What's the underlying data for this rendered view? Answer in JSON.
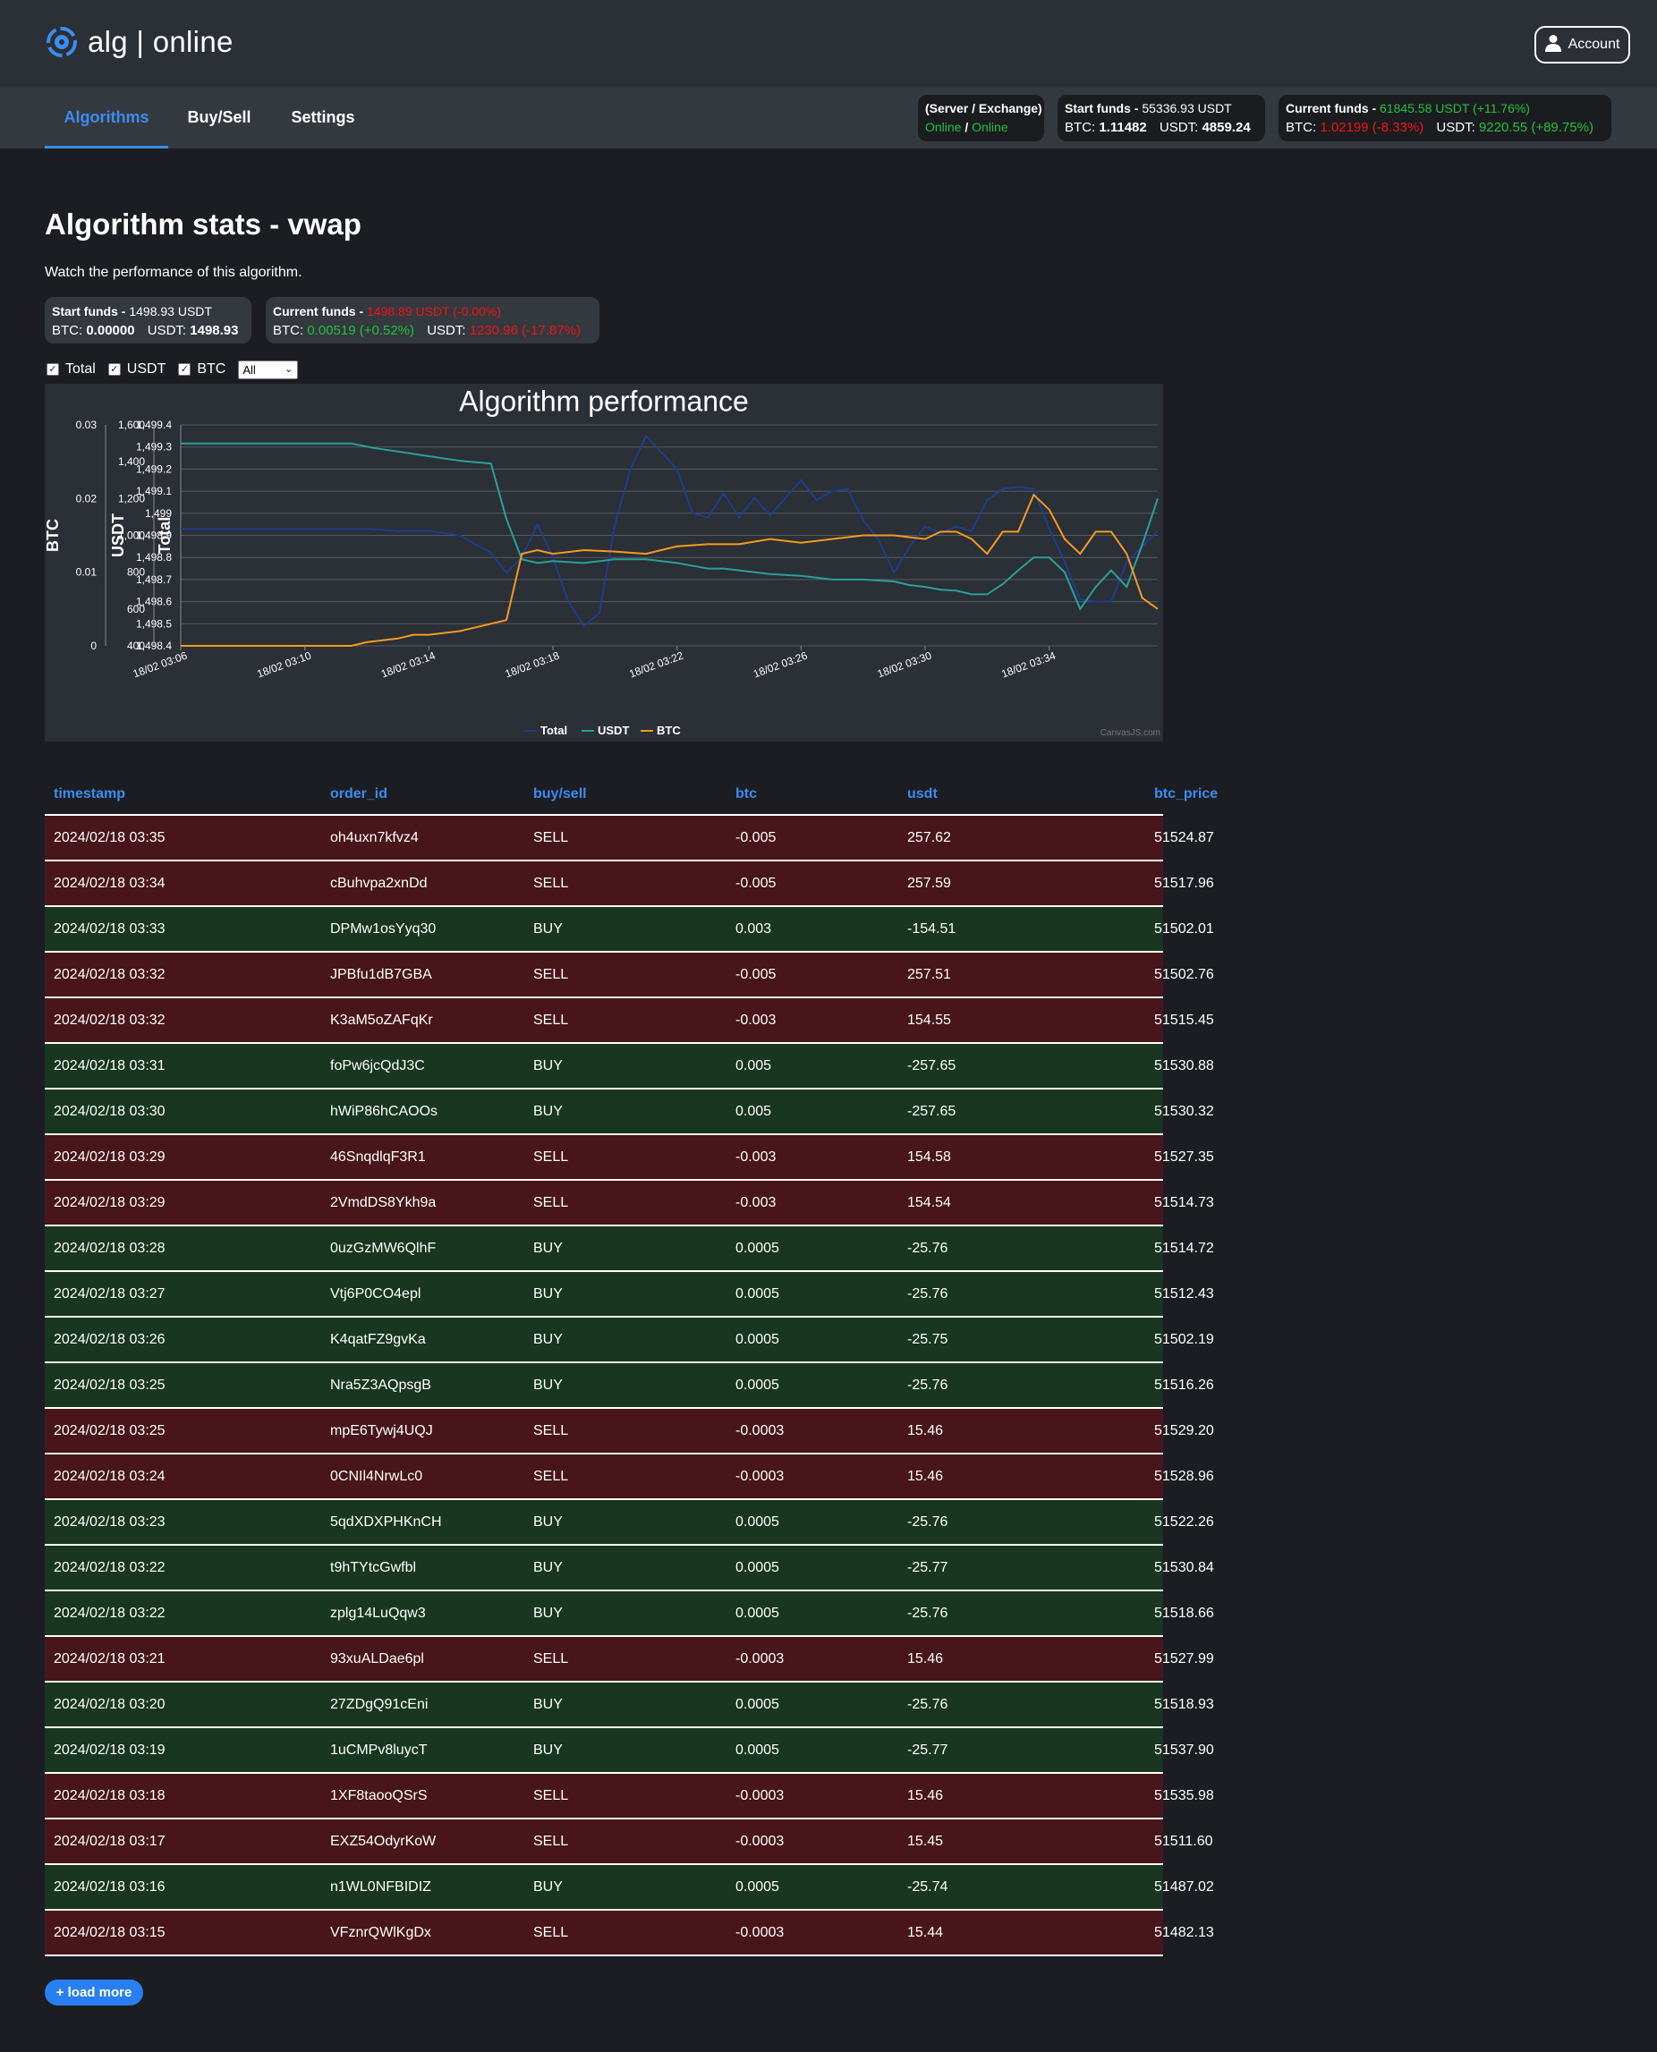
{
  "app": {
    "logo_text": "alg | online",
    "account_label": "Account"
  },
  "nav": {
    "tabs": [
      {
        "label": "Algorithms",
        "active": true
      },
      {
        "label": "Buy/Sell",
        "active": false
      },
      {
        "label": "Settings",
        "active": false
      }
    ]
  },
  "status": {
    "server_label": "(Server / Exchange)",
    "server_status": "Online",
    "separator": "/",
    "exchange_status": "Online",
    "start_funds_label": "Start funds - ",
    "start_funds_value": "55336.93 USDT",
    "start_btc_label": "BTC: ",
    "start_btc_value": "1.11482",
    "start_usdt_label": "USDT: ",
    "start_usdt_value": "4859.24",
    "current_funds_label": "Current funds - ",
    "current_funds_value": "61845.58 USDT (+11.76%)",
    "current_btc_label": "BTC: ",
    "current_btc_value": "1.02199 (-8.33%)",
    "current_usdt_label": "USDT: ",
    "current_usdt_value": "9220.55 (+89.75%)"
  },
  "page": {
    "title": "Algorithm stats - vwap",
    "subtitle": "Watch the performance of this algorithm.",
    "start_funds_label": "Start funds - ",
    "start_funds_value": "1498.93 USDT",
    "start_btc_label": "BTC: ",
    "start_btc_value": "0.00000",
    "start_usdt_label": "USDT: ",
    "start_usdt_value": "1498.93",
    "current_funds_label": "Current funds - ",
    "current_funds_value": "1498.89 USDT (-0.00%)",
    "current_btc_label": "BTC: ",
    "current_btc_value": "0.00519 (+0.52%)",
    "current_usdt_label": "USDT: ",
    "current_usdt_value": "1230.96 (-17.87%)"
  },
  "filters": {
    "checkboxes": [
      {
        "label": "Total",
        "checked": true
      },
      {
        "label": "USDT",
        "checked": true
      },
      {
        "label": "BTC",
        "checked": true
      }
    ],
    "range_select": "All"
  },
  "colors": {
    "total": "#1f3d8c",
    "usdt": "#2aa198",
    "btc": "#f59a23",
    "accent": "#3b8df0",
    "sell_row": "#47151a",
    "buy_row": "#183620"
  },
  "chart_data": {
    "type": "line",
    "title": "Algorithm performance",
    "credit": "CanvasJS.com",
    "x_ticks": [
      "18/02 03:06",
      "18/02 03:10",
      "18/02 03:14",
      "18/02 03:18",
      "18/02 03:22",
      "18/02 03:26",
      "18/02 03:30",
      "18/02 03:34"
    ],
    "xlim_minutes": [
      0,
      31.5
    ],
    "axes": {
      "btc": {
        "title": "BTC",
        "ylim": [
          0,
          0.03
        ],
        "ticks": [
          "0",
          "0.01",
          "0.02",
          "0.03"
        ],
        "tick_values": [
          0,
          0.01,
          0.02,
          0.03
        ]
      },
      "usdt": {
        "title": "USDT",
        "ylim": [
          400,
          1600
        ],
        "ticks": [
          "400",
          "600",
          "800",
          "1,000",
          "1,200",
          "1,400",
          "1,600"
        ],
        "tick_values": [
          400,
          600,
          800,
          1000,
          1200,
          1400,
          1600
        ]
      },
      "total": {
        "title": "Total",
        "ylim": [
          1498.4,
          1499.4
        ],
        "ticks": [
          "1,498.4",
          "1,498.5",
          "1,498.6",
          "1,498.7",
          "1,498.8",
          "1,498.9",
          "1,499",
          "1,499.1",
          "1,499.2",
          "1,499.3",
          "1,499.4"
        ],
        "tick_values": [
          1498.4,
          1498.5,
          1498.6,
          1498.7,
          1498.8,
          1498.9,
          1499.0,
          1499.1,
          1499.2,
          1499.3,
          1499.4
        ]
      }
    },
    "legend": [
      "Total",
      "USDT",
      "BTC"
    ],
    "legend_position": "bottom",
    "series": [
      {
        "name": "Total",
        "axis": "total",
        "x": [
          0,
          2,
          4,
          6,
          7,
          8,
          9,
          10,
          10.5,
          11,
          11.5,
          12,
          12.5,
          13,
          13.5,
          14,
          14.5,
          15,
          16,
          16.5,
          17,
          17.5,
          18,
          18.5,
          19,
          19.5,
          20,
          20.5,
          21,
          21.5,
          22,
          22.5,
          23,
          23.5,
          24,
          24.5,
          25,
          25.5,
          26,
          26.5,
          27,
          27.5,
          28,
          28.5,
          29,
          29.5,
          30,
          30.5,
          31,
          31.5
        ],
        "y": [
          1498.93,
          1498.93,
          1498.93,
          1498.93,
          1498.92,
          1498.92,
          1498.9,
          1498.82,
          1498.73,
          1498.8,
          1498.95,
          1498.8,
          1498.6,
          1498.49,
          1498.55,
          1498.95,
          1499.2,
          1499.35,
          1499.2,
          1499.0,
          1498.98,
          1499.09,
          1498.98,
          1499.07,
          1498.99,
          1499.07,
          1499.15,
          1499.06,
          1499.1,
          1499.11,
          1498.97,
          1498.88,
          1498.73,
          1498.85,
          1498.94,
          1498.91,
          1498.94,
          1498.92,
          1499.06,
          1499.11,
          1499.12,
          1499.11,
          1498.93,
          1498.78,
          1498.61,
          1498.6,
          1498.6,
          1498.78,
          1498.85,
          1498.92
        ]
      },
      {
        "name": "USDT",
        "axis": "usdt",
        "x": [
          0,
          2,
          4,
          5.5,
          6.2,
          7,
          8,
          9,
          10,
          10.5,
          11,
          11.5,
          12,
          13,
          14,
          15,
          16,
          17,
          17.5,
          18,
          19,
          20,
          21,
          22,
          23,
          23.5,
          24,
          24.5,
          25,
          25.5,
          26,
          26.5,
          27,
          27.5,
          28,
          28.5,
          29,
          29.5,
          30,
          30.5,
          31,
          31.5
        ],
        "y": [
          1498.93,
          1498.93,
          1498.93,
          1498.93,
          1475,
          1455,
          1430,
          1405,
          1390,
          1090,
          870,
          850,
          860,
          850,
          870,
          870,
          850,
          820,
          820,
          810,
          790,
          780,
          760,
          760,
          750,
          730,
          720,
          705,
          700,
          680,
          680,
          735,
          810,
          880,
          880,
          800,
          600,
          720,
          810,
          720,
          950,
          1200
        ]
      },
      {
        "name": "BTC",
        "axis": "btc",
        "x": [
          0,
          4,
          5.5,
          6,
          7,
          7.5,
          8,
          9,
          10,
          10.5,
          11,
          11.5,
          12,
          13,
          14,
          15,
          16,
          17,
          18,
          19,
          20,
          21,
          22,
          23,
          24,
          24.5,
          25,
          25.5,
          26,
          26.5,
          27,
          27.5,
          28,
          28.5,
          29,
          29.5,
          30,
          30.5,
          31,
          31.5
        ],
        "y": [
          0.0,
          0.0,
          0.0,
          0.0005,
          0.001,
          0.0015,
          0.0015,
          0.002,
          0.003,
          0.0035,
          0.0125,
          0.013,
          0.0125,
          0.013,
          0.0128,
          0.0125,
          0.0135,
          0.0138,
          0.0138,
          0.0145,
          0.014,
          0.0145,
          0.015,
          0.015,
          0.0145,
          0.0155,
          0.0155,
          0.0145,
          0.0125,
          0.0155,
          0.0155,
          0.0205,
          0.0185,
          0.0145,
          0.0125,
          0.0155,
          0.0155,
          0.0125,
          0.0065,
          0.005
        ]
      }
    ]
  },
  "table": {
    "headers": [
      "timestamp",
      "order_id",
      "buy/sell",
      "btc",
      "usdt",
      "btc_price"
    ],
    "rows": [
      [
        "2024/02/18 03:35",
        "oh4uxn7kfvz4",
        "SELL",
        "-0.005",
        "257.62",
        "51524.87"
      ],
      [
        "2024/02/18 03:34",
        "cBuhvpa2xnDd",
        "SELL",
        "-0.005",
        "257.59",
        "51517.96"
      ],
      [
        "2024/02/18 03:33",
        "DPMw1osYyq30",
        "BUY",
        "0.003",
        "-154.51",
        "51502.01"
      ],
      [
        "2024/02/18 03:32",
        "JPBfu1dB7GBA",
        "SELL",
        "-0.005",
        "257.51",
        "51502.76"
      ],
      [
        "2024/02/18 03:32",
        "K3aM5oZAFqKr",
        "SELL",
        "-0.003",
        "154.55",
        "51515.45"
      ],
      [
        "2024/02/18 03:31",
        "foPw6jcQdJ3C",
        "BUY",
        "0.005",
        "-257.65",
        "51530.88"
      ],
      [
        "2024/02/18 03:30",
        "hWiP86hCAOOs",
        "BUY",
        "0.005",
        "-257.65",
        "51530.32"
      ],
      [
        "2024/02/18 03:29",
        "46SnqdlqF3R1",
        "SELL",
        "-0.003",
        "154.58",
        "51527.35"
      ],
      [
        "2024/02/18 03:29",
        "2VmdDS8Ykh9a",
        "SELL",
        "-0.003",
        "154.54",
        "51514.73"
      ],
      [
        "2024/02/18 03:28",
        "0uzGzMW6QlhF",
        "BUY",
        "0.0005",
        "-25.76",
        "51514.72"
      ],
      [
        "2024/02/18 03:27",
        "Vtj6P0CO4epl",
        "BUY",
        "0.0005",
        "-25.76",
        "51512.43"
      ],
      [
        "2024/02/18 03:26",
        "K4qatFZ9gvKa",
        "BUY",
        "0.0005",
        "-25.75",
        "51502.19"
      ],
      [
        "2024/02/18 03:25",
        "Nra5Z3AQpsgB",
        "BUY",
        "0.0005",
        "-25.76",
        "51516.26"
      ],
      [
        "2024/02/18 03:25",
        "mpE6Tywj4UQJ",
        "SELL",
        "-0.0003",
        "15.46",
        "51529.20"
      ],
      [
        "2024/02/18 03:24",
        "0CNIl4NrwLc0",
        "SELL",
        "-0.0003",
        "15.46",
        "51528.96"
      ],
      [
        "2024/02/18 03:23",
        "5qdXDXPHKnCH",
        "BUY",
        "0.0005",
        "-25.76",
        "51522.26"
      ],
      [
        "2024/02/18 03:22",
        "t9hTYtcGwfbl",
        "BUY",
        "0.0005",
        "-25.77",
        "51530.84"
      ],
      [
        "2024/02/18 03:22",
        "zplg14LuQqw3",
        "BUY",
        "0.0005",
        "-25.76",
        "51518.66"
      ],
      [
        "2024/02/18 03:21",
        "93xuALDae6pl",
        "SELL",
        "-0.0003",
        "15.46",
        "51527.99"
      ],
      [
        "2024/02/18 03:20",
        "27ZDgQ91cEni",
        "BUY",
        "0.0005",
        "-25.76",
        "51518.93"
      ],
      [
        "2024/02/18 03:19",
        "1uCMPv8luycT",
        "BUY",
        "0.0005",
        "-25.77",
        "51537.90"
      ],
      [
        "2024/02/18 03:18",
        "1XF8taooQSrS",
        "SELL",
        "-0.0003",
        "15.46",
        "51535.98"
      ],
      [
        "2024/02/18 03:17",
        "EXZ54OdyrKoW",
        "SELL",
        "-0.0003",
        "15.45",
        "51511.60"
      ],
      [
        "2024/02/18 03:16",
        "n1WL0NFBIDIZ",
        "BUY",
        "0.0005",
        "-25.74",
        "51487.02"
      ],
      [
        "2024/02/18 03:15",
        "VFznrQWlKgDx",
        "SELL",
        "-0.0003",
        "15.44",
        "51482.13"
      ]
    ]
  },
  "load_more_label": "+ load more"
}
